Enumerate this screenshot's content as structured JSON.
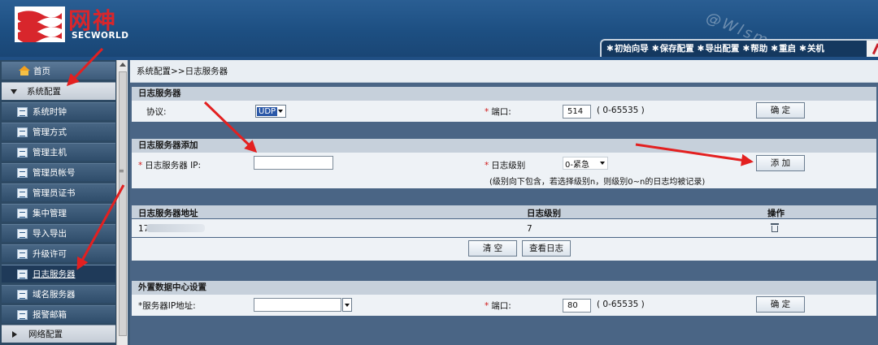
{
  "brand": {
    "name_cn": "网神",
    "name_en": "SECWORLD"
  },
  "watermark_text": "@Wlsmz",
  "topbar": {
    "items": [
      "初始向导",
      "保存配置",
      "导出配置",
      "帮助",
      "重启",
      "关机"
    ]
  },
  "sidebar": {
    "home": "首页",
    "group_open": "系统配置",
    "items": [
      "系统时钟",
      "管理方式",
      "管理主机",
      "管理员帐号",
      "管理员证书",
      "集中管理",
      "导入导出",
      "升级许可",
      "日志服务器",
      "域名服务器",
      "报警邮箱"
    ],
    "active_item": "日志服务器",
    "group_closed": "网络配置"
  },
  "breadcrumb": "系统配置>>日志服务器",
  "log_server": {
    "title": "日志服务器",
    "protocol_label": "协议:",
    "protocol_value": "UDP",
    "port_label": "端口:",
    "port_value": "514",
    "port_range": "( 0-65535 )",
    "confirm_label": "确 定"
  },
  "add_server": {
    "title": "日志服务器添加",
    "ip_label": "日志服务器 IP:",
    "ip_value": "",
    "level_label": "日志级别",
    "level_value": "0-紧急",
    "add_label": "添 加",
    "hint": "(级别向下包含，若选择级别n，则级别0~n的日志均被记录)"
  },
  "server_table": {
    "columns": [
      "日志服务器地址",
      "日志级别",
      "操作"
    ],
    "rows": [
      {
        "address": "17",
        "level": "7"
      }
    ],
    "clear_label": "清 空",
    "view_log_label": "查看日志"
  },
  "external_center": {
    "title": "外置数据中心设置",
    "ip_label": "*服务器IP地址:",
    "ip_value": "",
    "port_label": "端口:",
    "port_value": "80",
    "port_range": "( 0-65535 )",
    "confirm_label": "确 定"
  },
  "colors": {
    "header_bg": "#1d4f82",
    "brand_red": "#d8262c",
    "required_red": "#d01818",
    "annotation_red": "#e32020"
  }
}
